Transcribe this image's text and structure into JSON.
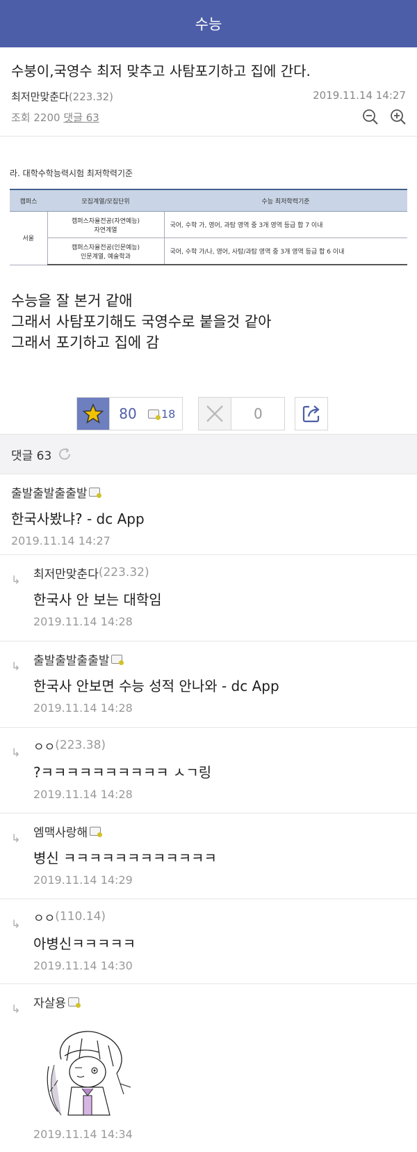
{
  "header": {
    "title": "수능"
  },
  "post": {
    "title": "수붕이,국영수 최저 맞추고 사탐포기하고 집에 간다.",
    "author": "최저만맞춘다",
    "author_ip": "(223.32)",
    "date": "2019.11.14 14:27",
    "views_label": "조회 2200",
    "comments_label": "댓글 63",
    "table": {
      "caption": "라. 대학수학능력시험 최저학력기준",
      "headers": [
        "캠퍼스",
        "모집계열/모집단위",
        "수능 최저학력기준"
      ],
      "campus": "서울",
      "rows": [
        {
          "unit1": "캠퍼스자율전공(자연예능)",
          "unit2": "자연계열",
          "criteria": "국어, 수학 가, 영어, 과탐   영역 중 3개 영역 등급 합 7 이내"
        },
        {
          "unit1": "캠퍼스자율전공(인문예능)",
          "unit2": "인문계열, 예술학과",
          "criteria": "국어, 수학 가/나, 영어, 사탐/과탐 영역 중 3개 영역 등급 합 6 이내"
        }
      ]
    },
    "body_lines": [
      "수능을 잘 본거 같애",
      "그래서 사탐포기해도 국영수로 붙을것 같아",
      "그래서 포기하고 집에 감"
    ],
    "recommend_count": "80",
    "fixed_recommend_count": "18",
    "nonrecommend_count": "0"
  },
  "comments_header": {
    "label": "댓글 63"
  },
  "comments": [
    {
      "reply": false,
      "name": "출발출발출출발",
      "ip": "",
      "badge": true,
      "text": "한국사봤냐? - dc App",
      "date": "2019.11.14 14:27"
    },
    {
      "reply": true,
      "name": "최저만맞춘다",
      "ip": "(223.32)",
      "badge": false,
      "text": "한국사 안 보는 대학임",
      "date": "2019.11.14 14:28"
    },
    {
      "reply": true,
      "name": "출발출발출출발",
      "ip": "",
      "badge": true,
      "text": "한국사 안보면 수능 성적 안나와 - dc App",
      "date": "2019.11.14 14:28"
    },
    {
      "reply": true,
      "name": "ㅇㅇ",
      "ip": "(223.38)",
      "badge": false,
      "text": "?ㅋㅋㅋㅋㅋㅋㅋㅋㅋㅋ ㅅㄱ링",
      "date": "2019.11.14 14:28"
    },
    {
      "reply": true,
      "name": "엠맥사랑해",
      "ip": "",
      "badge": true,
      "text": "병신 ㅋㅋㅋㅋㅋㅋㅋㅋㅋㅋㅋㅋ",
      "date": "2019.11.14 14:29"
    },
    {
      "reply": true,
      "name": "ㅇㅇ",
      "ip": "(110.14)",
      "badge": false,
      "text": "아병신ㅋㅋㅋㅋㅋ",
      "date": "2019.11.14 14:30"
    },
    {
      "reply": true,
      "name": "자살용",
      "ip": "",
      "badge": true,
      "text": "",
      "date": "2019.11.14 14:34",
      "sticker": true
    }
  ],
  "colors": {
    "brand": "#4d5ea8",
    "recommend_bg": "#6e7fbf",
    "star": "#f2c200"
  },
  "icons": [
    "zoom-out-icon",
    "zoom-in-icon",
    "star-icon",
    "fix-badge-icon",
    "close-x-icon",
    "share-icon",
    "refresh-icon",
    "reply-arrow-icon"
  ]
}
